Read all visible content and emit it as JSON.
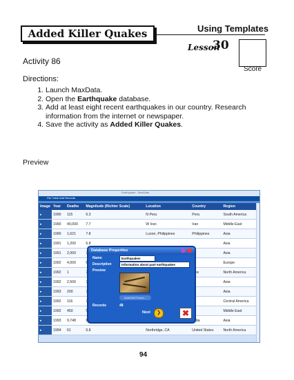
{
  "header": {
    "title": "Added Killer Quakes",
    "section": "Using Templates",
    "lesson_word": "Lesson",
    "lesson_number": "30",
    "score_label": "Score"
  },
  "activity": "Activity 86",
  "directions_label": "Directions:",
  "steps": [
    "Launch MaxData.",
    "Open the Earthquake database.",
    "Add at least eight recent earthquakes in our country. Research information from the internet or newspaper.",
    "Save the activity as Added Killer Quakes."
  ],
  "step_bold": {
    "db": "Earthquake",
    "save": "Added Killer Quakes"
  },
  "preview_label": "Preview",
  "screenshot": {
    "window_title": "Earthquake - MaxData",
    "menu": "File   Table   Add Records",
    "columns": [
      "Image",
      "Year",
      "Deaths",
      "Magnitude (Richter Scale)",
      "Location",
      "Country",
      "Region"
    ],
    "rows": [
      [
        "",
        "1990",
        "115",
        "6.3",
        "N Peru",
        "Peru",
        "South America"
      ],
      [
        "",
        "1990",
        "40,000",
        "7.7",
        "W Iran",
        "Iran",
        "Middle East"
      ],
      [
        "",
        "1990",
        "1,621",
        "7.8",
        "Luzon, Philippines",
        "Philippines",
        "Asia"
      ],
      [
        "",
        "1991",
        "1,200",
        "6.8",
        "",
        "",
        "Asia"
      ],
      [
        "",
        "1991",
        "2,000",
        "7.0",
        "",
        "",
        "Asia"
      ],
      [
        "",
        "1992",
        "4,000",
        "6.2",
        "",
        "",
        "Europe"
      ],
      [
        "",
        "1992",
        "1",
        "7.5",
        "",
        "ates",
        "North America"
      ],
      [
        "",
        "1992",
        "2,500",
        "7.5",
        "",
        "",
        "Asia"
      ],
      [
        "",
        "1993",
        "200",
        "7.7",
        "",
        "",
        "Asia"
      ],
      [
        "",
        "1992",
        "116",
        "7.0",
        "",
        "a",
        "Central America"
      ],
      [
        "",
        "1992",
        "450",
        "5.9",
        "",
        "",
        "Middle East"
      ],
      [
        "",
        "1993",
        "9,748",
        "6.3",
        "Maharashtra, S India",
        "India",
        "Asia"
      ],
      [
        "",
        "1994",
        "61",
        "6.8",
        "Northridge, CA",
        "United States",
        "North America"
      ]
    ],
    "dialog": {
      "title": "Database Properties",
      "name_label": "Name",
      "name_value": "Earthquakes",
      "description_label": "Description",
      "description_value": "Information about past earthquakes",
      "preview_label": "Preview",
      "add_picture": "Add/Edit Picture...",
      "records_label": "Records",
      "records_value": "48",
      "next_label": "Next"
    }
  },
  "page_number": "94"
}
